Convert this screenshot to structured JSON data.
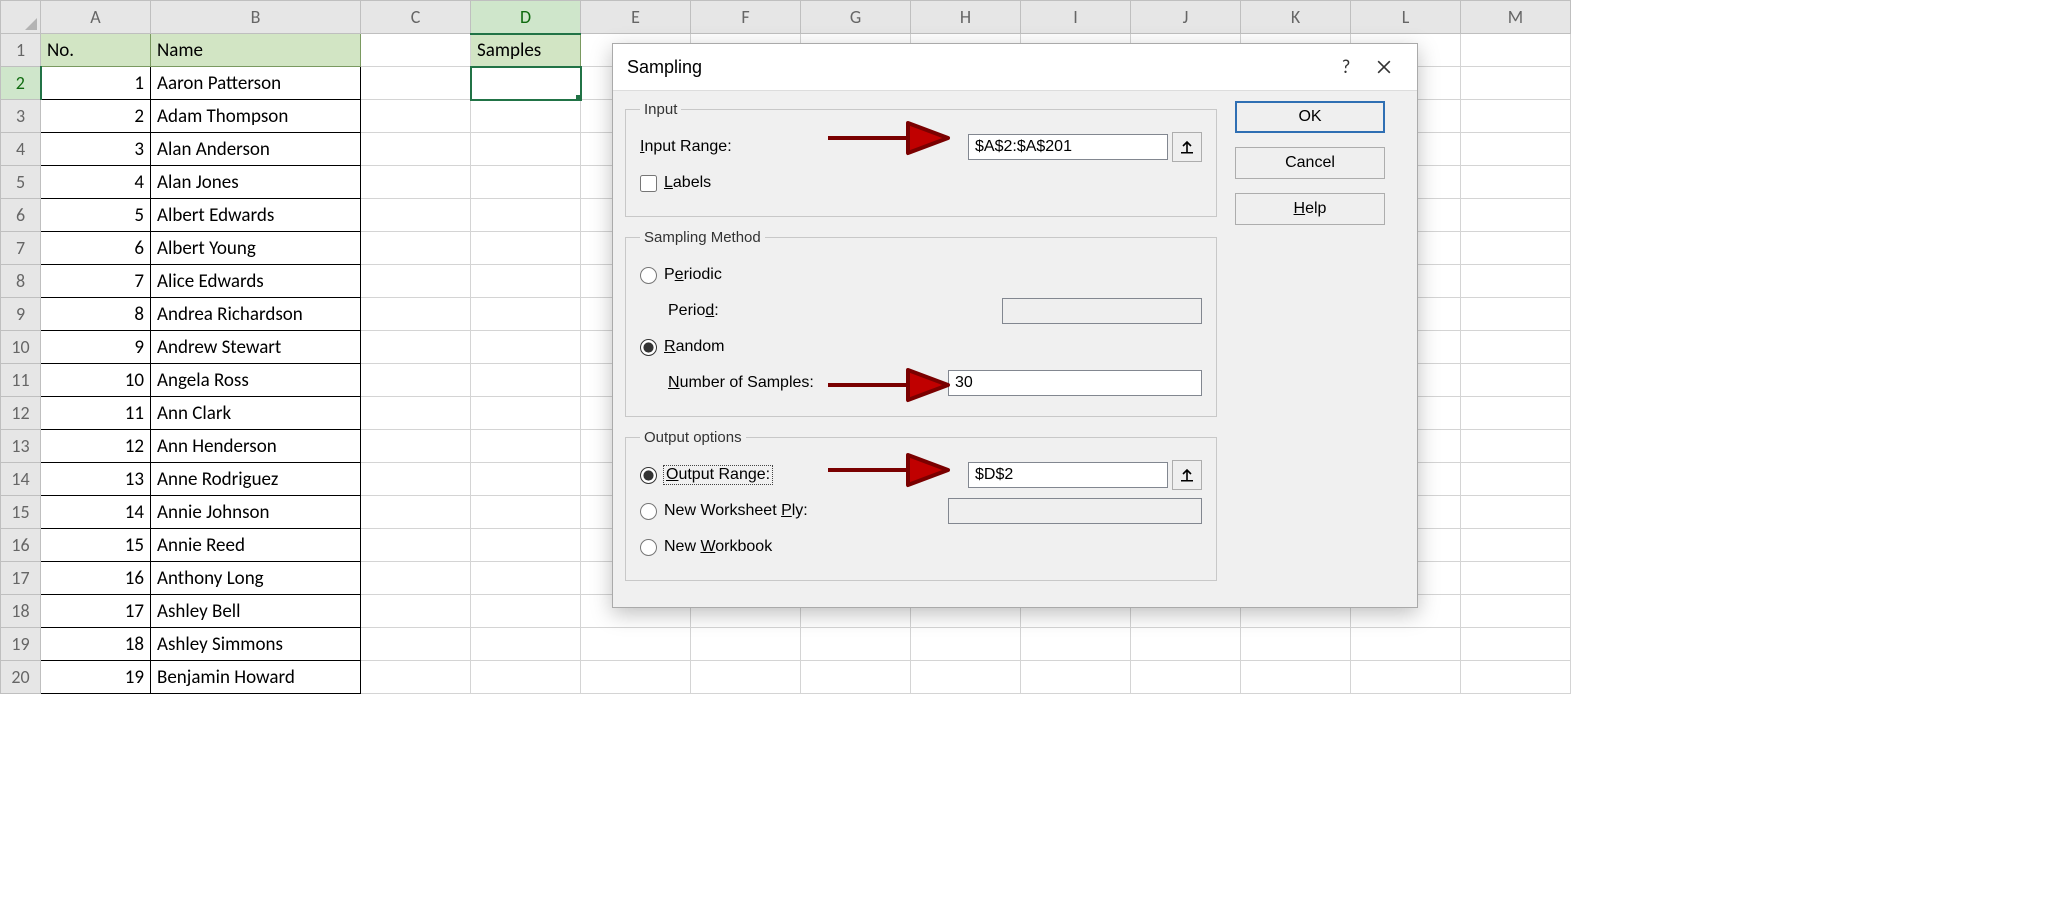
{
  "columns": [
    "A",
    "B",
    "C",
    "D",
    "E",
    "F",
    "G",
    "H",
    "I",
    "J",
    "K",
    "L",
    "M"
  ],
  "header": {
    "a": "No.",
    "b": "Name",
    "d": "Samples"
  },
  "rows": [
    {
      "n": 1,
      "name": "Aaron Patterson"
    },
    {
      "n": 2,
      "name": "Adam Thompson"
    },
    {
      "n": 3,
      "name": "Alan Anderson"
    },
    {
      "n": 4,
      "name": "Alan Jones"
    },
    {
      "n": 5,
      "name": "Albert Edwards"
    },
    {
      "n": 6,
      "name": "Albert Young"
    },
    {
      "n": 7,
      "name": "Alice Edwards"
    },
    {
      "n": 8,
      "name": "Andrea Richardson"
    },
    {
      "n": 9,
      "name": "Andrew Stewart"
    },
    {
      "n": 10,
      "name": "Angela Ross"
    },
    {
      "n": 11,
      "name": "Ann Clark"
    },
    {
      "n": 12,
      "name": "Ann Henderson"
    },
    {
      "n": 13,
      "name": "Anne Rodriguez"
    },
    {
      "n": 14,
      "name": "Annie Johnson"
    },
    {
      "n": 15,
      "name": "Annie Reed"
    },
    {
      "n": 16,
      "name": "Anthony Long"
    },
    {
      "n": 17,
      "name": "Ashley Bell"
    },
    {
      "n": 18,
      "name": "Ashley Simmons"
    },
    {
      "n": 19,
      "name": "Benjamin Howard"
    }
  ],
  "dialog": {
    "title": "Sampling",
    "buttons": {
      "ok": "OK",
      "cancel": "Cancel",
      "help": "Help"
    },
    "input_group": "Input",
    "input_range_label": "Input Range:",
    "input_range_value": "$A$2:$A$201",
    "labels_label": "Labels",
    "sampling_group": "Sampling Method",
    "periodic_label": "Periodic",
    "period_label": "Period:",
    "period_value": "",
    "random_label": "Random",
    "num_samples_label": "Number of Samples:",
    "num_samples_value": "30",
    "output_group": "Output options",
    "output_range_label": "Output Range:",
    "output_range_value": "$D$2",
    "new_ws_label": "New Worksheet Ply:",
    "new_ws_value": "",
    "new_wb_label": "New Workbook"
  },
  "selected_sampling": "random",
  "selected_output": "output_range"
}
